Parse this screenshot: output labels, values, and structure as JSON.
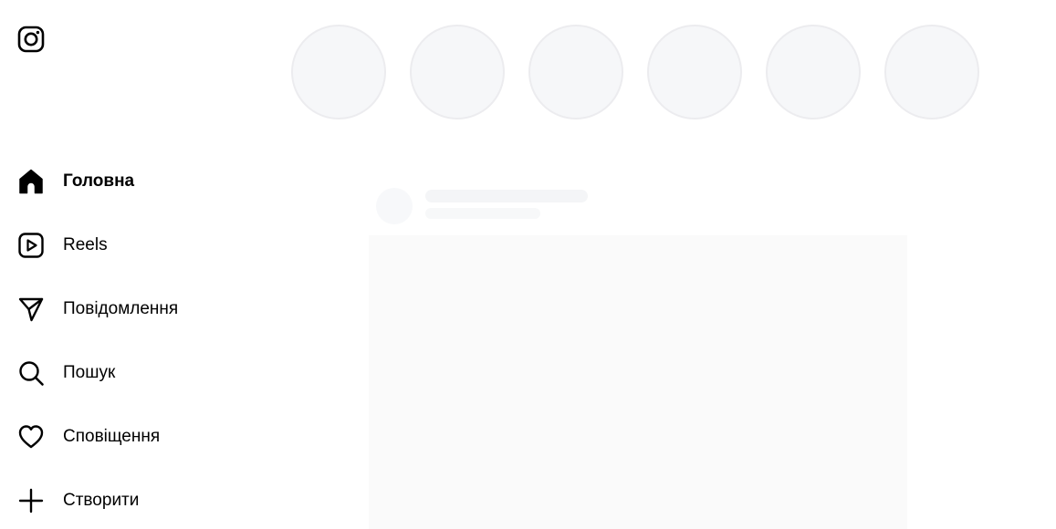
{
  "sidebar": {
    "logo_icon": "instagram-logo-icon",
    "items": [
      {
        "label": "Головна",
        "icon": "home-icon",
        "active": true
      },
      {
        "label": "Reels",
        "icon": "reels-icon",
        "active": false
      },
      {
        "label": "Повідомлення",
        "icon": "messages-icon",
        "active": false
      },
      {
        "label": "Пошук",
        "icon": "search-icon",
        "active": false
      },
      {
        "label": "Сповіщення",
        "icon": "heart-icon",
        "active": false
      },
      {
        "label": "Створити",
        "icon": "plus-icon",
        "active": false
      }
    ]
  },
  "stories": {
    "count": 6,
    "state": "loading-skeleton"
  },
  "feed": {
    "state": "loading-skeleton"
  },
  "colors": {
    "text": "#000000",
    "background": "#ffffff",
    "skeleton": "#f6f7f9",
    "skeleton_border": "#ececef"
  }
}
